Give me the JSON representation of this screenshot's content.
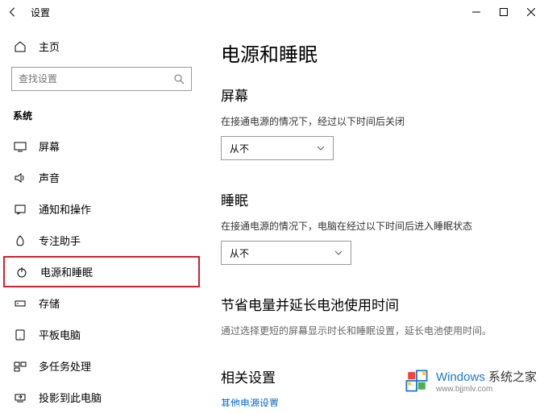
{
  "titlebar": {
    "title": "设置"
  },
  "sidebar": {
    "home_label": "主页",
    "search_placeholder": "查找设置",
    "section_label": "系统",
    "items": [
      {
        "label": "屏幕"
      },
      {
        "label": "声音"
      },
      {
        "label": "通知和操作"
      },
      {
        "label": "专注助手"
      },
      {
        "label": "电源和睡眠"
      },
      {
        "label": "存储"
      },
      {
        "label": "平板电脑"
      },
      {
        "label": "多任务处理"
      },
      {
        "label": "投影到此电脑"
      }
    ]
  },
  "content": {
    "page_title": "电源和睡眠",
    "screen": {
      "heading": "屏幕",
      "desc": "在接通电源的情况下，经过以下时间后关闭",
      "value": "从不"
    },
    "sleep": {
      "heading": "睡眠",
      "desc": "在接通电源的情况下，电脑在经过以下时间后进入睡眠状态",
      "value": "从不"
    },
    "battery": {
      "heading": "节省电量并延长电池使用时间",
      "desc": "通过选择更短的屏幕显示时长和睡眠设置，延长电池使用时间。"
    },
    "related": {
      "heading": "相关设置",
      "link": "其他电源设置"
    }
  },
  "watermark": {
    "brand_prefix": "Windows",
    "brand_suffix": " 系统之家",
    "url": "www.bjjmlv.com"
  }
}
